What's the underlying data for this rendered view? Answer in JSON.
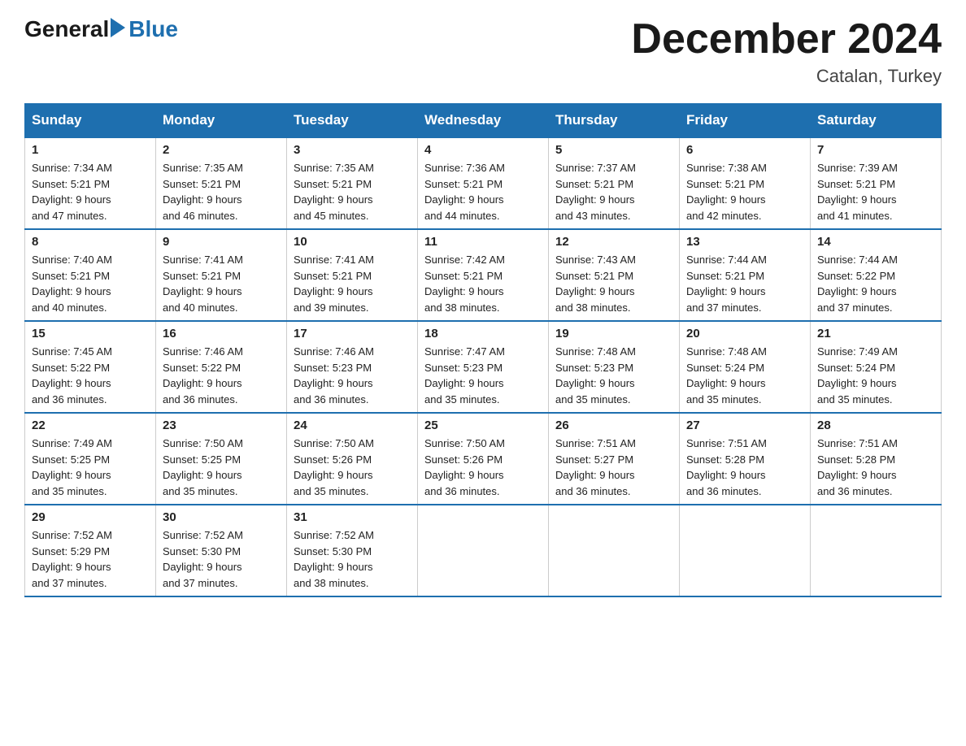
{
  "header": {
    "logo_general": "General",
    "logo_blue": "Blue",
    "month_title": "December 2024",
    "subtitle": "Catalan, Turkey"
  },
  "days_of_week": [
    "Sunday",
    "Monday",
    "Tuesday",
    "Wednesday",
    "Thursday",
    "Friday",
    "Saturday"
  ],
  "weeks": [
    [
      {
        "day": "1",
        "sunrise": "7:34 AM",
        "sunset": "5:21 PM",
        "daylight": "9 hours and 47 minutes."
      },
      {
        "day": "2",
        "sunrise": "7:35 AM",
        "sunset": "5:21 PM",
        "daylight": "9 hours and 46 minutes."
      },
      {
        "day": "3",
        "sunrise": "7:35 AM",
        "sunset": "5:21 PM",
        "daylight": "9 hours and 45 minutes."
      },
      {
        "day": "4",
        "sunrise": "7:36 AM",
        "sunset": "5:21 PM",
        "daylight": "9 hours and 44 minutes."
      },
      {
        "day": "5",
        "sunrise": "7:37 AM",
        "sunset": "5:21 PM",
        "daylight": "9 hours and 43 minutes."
      },
      {
        "day": "6",
        "sunrise": "7:38 AM",
        "sunset": "5:21 PM",
        "daylight": "9 hours and 42 minutes."
      },
      {
        "day": "7",
        "sunrise": "7:39 AM",
        "sunset": "5:21 PM",
        "daylight": "9 hours and 41 minutes."
      }
    ],
    [
      {
        "day": "8",
        "sunrise": "7:40 AM",
        "sunset": "5:21 PM",
        "daylight": "9 hours and 40 minutes."
      },
      {
        "day": "9",
        "sunrise": "7:41 AM",
        "sunset": "5:21 PM",
        "daylight": "9 hours and 40 minutes."
      },
      {
        "day": "10",
        "sunrise": "7:41 AM",
        "sunset": "5:21 PM",
        "daylight": "9 hours and 39 minutes."
      },
      {
        "day": "11",
        "sunrise": "7:42 AM",
        "sunset": "5:21 PM",
        "daylight": "9 hours and 38 minutes."
      },
      {
        "day": "12",
        "sunrise": "7:43 AM",
        "sunset": "5:21 PM",
        "daylight": "9 hours and 38 minutes."
      },
      {
        "day": "13",
        "sunrise": "7:44 AM",
        "sunset": "5:21 PM",
        "daylight": "9 hours and 37 minutes."
      },
      {
        "day": "14",
        "sunrise": "7:44 AM",
        "sunset": "5:22 PM",
        "daylight": "9 hours and 37 minutes."
      }
    ],
    [
      {
        "day": "15",
        "sunrise": "7:45 AM",
        "sunset": "5:22 PM",
        "daylight": "9 hours and 36 minutes."
      },
      {
        "day": "16",
        "sunrise": "7:46 AM",
        "sunset": "5:22 PM",
        "daylight": "9 hours and 36 minutes."
      },
      {
        "day": "17",
        "sunrise": "7:46 AM",
        "sunset": "5:23 PM",
        "daylight": "9 hours and 36 minutes."
      },
      {
        "day": "18",
        "sunrise": "7:47 AM",
        "sunset": "5:23 PM",
        "daylight": "9 hours and 35 minutes."
      },
      {
        "day": "19",
        "sunrise": "7:48 AM",
        "sunset": "5:23 PM",
        "daylight": "9 hours and 35 minutes."
      },
      {
        "day": "20",
        "sunrise": "7:48 AM",
        "sunset": "5:24 PM",
        "daylight": "9 hours and 35 minutes."
      },
      {
        "day": "21",
        "sunrise": "7:49 AM",
        "sunset": "5:24 PM",
        "daylight": "9 hours and 35 minutes."
      }
    ],
    [
      {
        "day": "22",
        "sunrise": "7:49 AM",
        "sunset": "5:25 PM",
        "daylight": "9 hours and 35 minutes."
      },
      {
        "day": "23",
        "sunrise": "7:50 AM",
        "sunset": "5:25 PM",
        "daylight": "9 hours and 35 minutes."
      },
      {
        "day": "24",
        "sunrise": "7:50 AM",
        "sunset": "5:26 PM",
        "daylight": "9 hours and 35 minutes."
      },
      {
        "day": "25",
        "sunrise": "7:50 AM",
        "sunset": "5:26 PM",
        "daylight": "9 hours and 36 minutes."
      },
      {
        "day": "26",
        "sunrise": "7:51 AM",
        "sunset": "5:27 PM",
        "daylight": "9 hours and 36 minutes."
      },
      {
        "day": "27",
        "sunrise": "7:51 AM",
        "sunset": "5:28 PM",
        "daylight": "9 hours and 36 minutes."
      },
      {
        "day": "28",
        "sunrise": "7:51 AM",
        "sunset": "5:28 PM",
        "daylight": "9 hours and 36 minutes."
      }
    ],
    [
      {
        "day": "29",
        "sunrise": "7:52 AM",
        "sunset": "5:29 PM",
        "daylight": "9 hours and 37 minutes."
      },
      {
        "day": "30",
        "sunrise": "7:52 AM",
        "sunset": "5:30 PM",
        "daylight": "9 hours and 37 minutes."
      },
      {
        "day": "31",
        "sunrise": "7:52 AM",
        "sunset": "5:30 PM",
        "daylight": "9 hours and 38 minutes."
      },
      null,
      null,
      null,
      null
    ]
  ],
  "labels": {
    "sunrise": "Sunrise:",
    "sunset": "Sunset:",
    "daylight": "Daylight:"
  }
}
